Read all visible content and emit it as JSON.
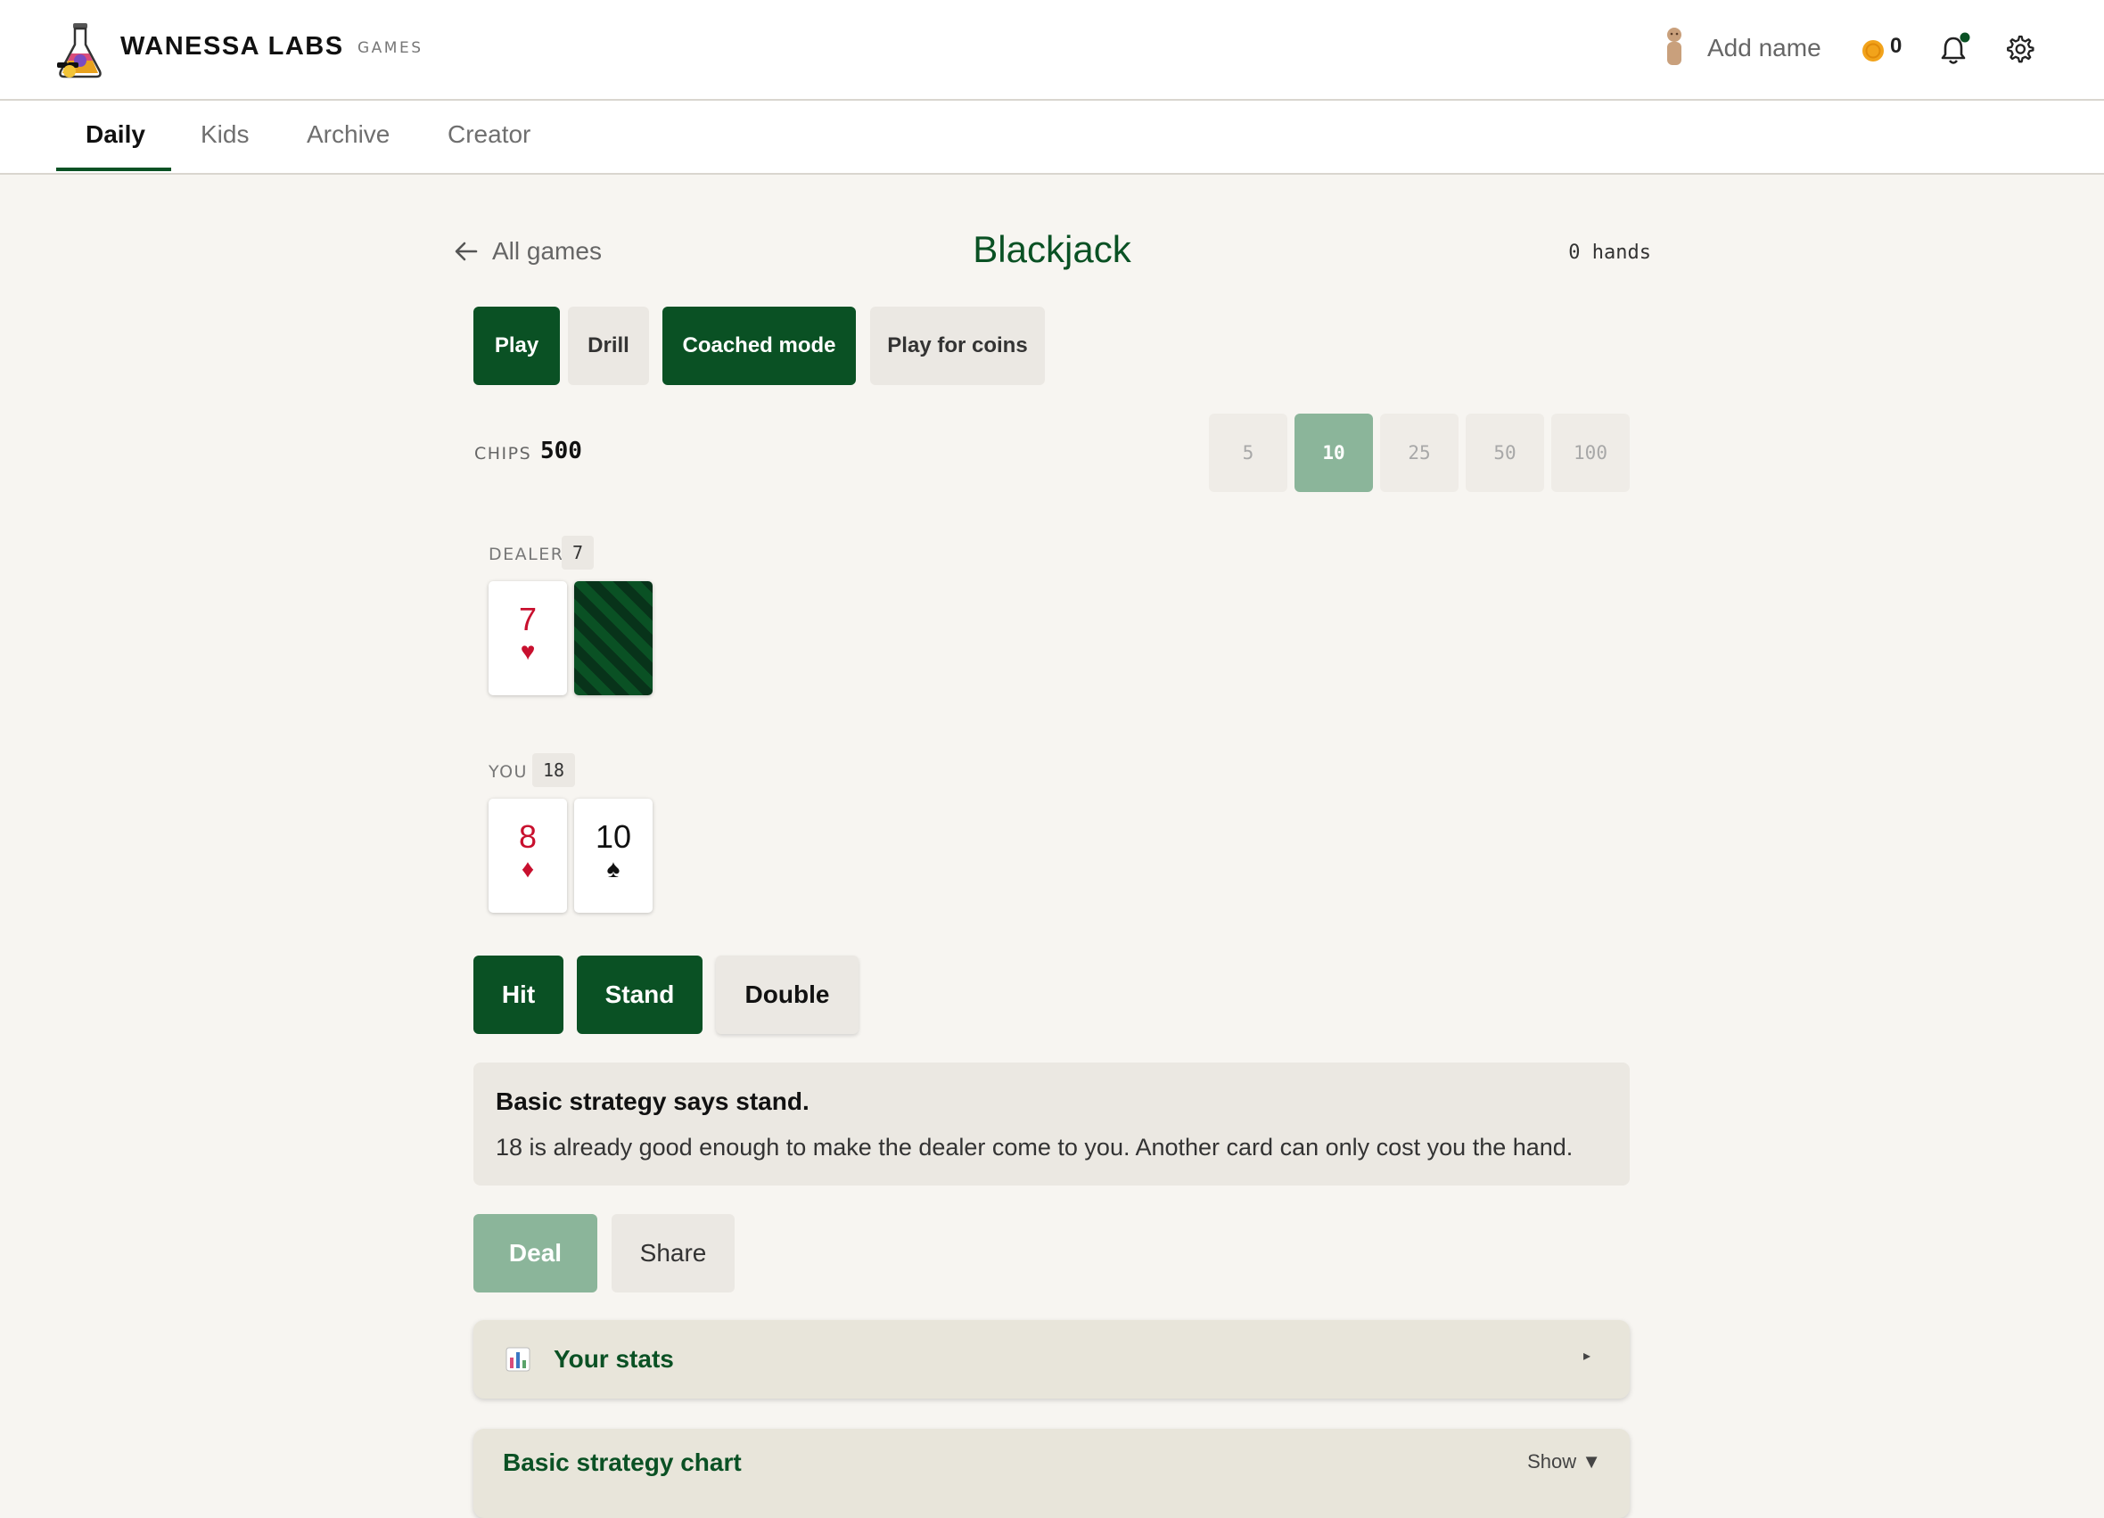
{
  "header": {
    "brand": "WANESSA LABS",
    "brand_sub": "GAMES",
    "user_name": "Add name",
    "coins": "0",
    "notification_dot_color": "#0a5124"
  },
  "nav": {
    "tabs": [
      {
        "label": "Daily",
        "active": true
      },
      {
        "label": "Kids",
        "active": false
      },
      {
        "label": "Archive",
        "active": false
      },
      {
        "label": "Creator",
        "active": false
      }
    ]
  },
  "game": {
    "back_label": "All games",
    "title": "Blackjack",
    "hands": "0 hands",
    "modes": [
      {
        "label": "Play",
        "active": true
      },
      {
        "label": "Drill",
        "active": false
      },
      {
        "label": "Coached mode",
        "active": true
      },
      {
        "label": "Play for coins",
        "active": false
      }
    ],
    "chips_label": "CHIPS",
    "chips_value": "500",
    "bets": [
      {
        "label": "5",
        "selected": false
      },
      {
        "label": "10",
        "selected": true
      },
      {
        "label": "25",
        "selected": false
      },
      {
        "label": "50",
        "selected": false
      },
      {
        "label": "100",
        "selected": false
      }
    ],
    "dealer": {
      "label": "DEALER",
      "score": "7",
      "cards": [
        {
          "rank": "7",
          "suit": "♥",
          "color": "red"
        },
        {
          "face_down": true
        }
      ]
    },
    "player": {
      "label": "YOU",
      "score": "18",
      "cards": [
        {
          "rank": "8",
          "suit": "♦",
          "color": "red"
        },
        {
          "rank": "10",
          "suit": "♠",
          "color": "black"
        }
      ]
    },
    "actions": {
      "hit": "Hit",
      "stand": "Stand",
      "double": "Double"
    },
    "tip": {
      "title": "Basic strategy says stand.",
      "text": "18 is already good enough to make the dealer come to you. Another card can only cost you the hand."
    },
    "deal_label": "Deal",
    "share_label": "Share",
    "stats_panel": {
      "title": "Your stats",
      "toggle": "▸"
    },
    "strategy_panel": {
      "title": "Basic strategy chart",
      "toggle": "Show ▼"
    }
  }
}
